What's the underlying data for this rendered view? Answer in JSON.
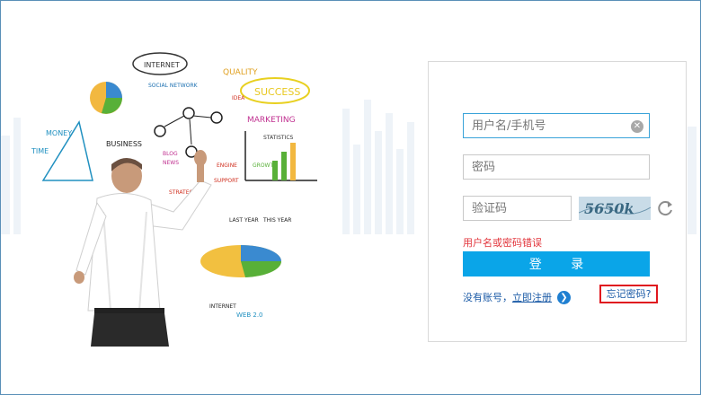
{
  "login": {
    "username_placeholder": "用户名/手机号",
    "password_placeholder": "密码",
    "captcha_placeholder": "验证码",
    "captcha_text": "5650k",
    "error_message": "用户名或密码错误",
    "login_button": "登 录",
    "no_account_text": "没有账号，",
    "register_link": "立即注册",
    "forgot_password": "忘记密码?"
  },
  "illustration": {
    "labels": [
      "INTERNET",
      "SOCIAL NETWORK",
      "QUALITY",
      "SUCCESS",
      "MARKETING",
      "STATISTICS",
      "MONEY",
      "BUSINESS",
      "GROWTH",
      "TIME",
      "LAST YEAR",
      "THIS YEAR",
      "INTERNET",
      "WEB 2.0",
      "STRATEGY",
      "SUPPORT",
      "ENGINE",
      "BLOG",
      "NEWS",
      "IDEA"
    ]
  },
  "colors": {
    "accent": "#0aa5e8",
    "error": "#e2343b",
    "link": "#1a5aa6",
    "highlight_box": "#e0181f"
  }
}
